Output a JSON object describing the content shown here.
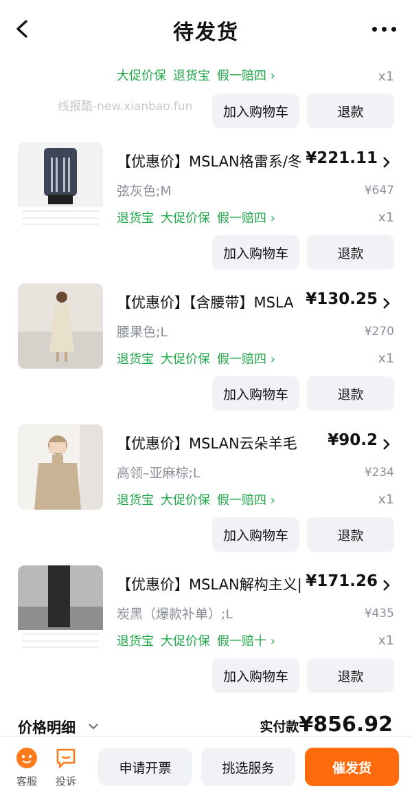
{
  "header": {
    "title": "待发货"
  },
  "watermark": "线报酷-new.xianbao.fun",
  "first_item_partial": {
    "tags": [
      "大促价保",
      "退货宝",
      "假一赔四 ›"
    ],
    "qty": "x1",
    "cart_label": "加入购物车",
    "refund_label": "退款"
  },
  "items": [
    {
      "title": "【优惠价】MSLAN格雷系/冬",
      "price": "¥221.11",
      "spec": "弦灰色;M",
      "orig_price": "¥647",
      "tags": [
        "退货宝",
        "大促价保",
        "假一赔四 ›"
      ],
      "qty": "x1",
      "cart_label": "加入购物车",
      "refund_label": "退款"
    },
    {
      "title": "【优惠价】【含腰带】MSLA",
      "price": "¥130.25",
      "spec": "腰果色;L",
      "orig_price": "¥270",
      "tags": [
        "退货宝",
        "大促价保",
        "假一赔四 ›"
      ],
      "qty": "x1",
      "cart_label": "加入购物车",
      "refund_label": "退款"
    },
    {
      "title": "【优惠价】MSLAN云朵羊毛",
      "price": "¥90.2",
      "spec": "高领–亚麻棕;L",
      "orig_price": "¥234",
      "tags": [
        "退货宝",
        "大促价保",
        "假一赔四 ›"
      ],
      "qty": "x1",
      "cart_label": "加入购物车",
      "refund_label": "退款"
    },
    {
      "title": "【优惠价】MSLAN解构主义|",
      "price": "¥171.26",
      "spec": "炭黑（爆款补单）;L",
      "orig_price": "¥435",
      "tags": [
        "退货宝",
        "大促价保",
        "假一赔十 ›"
      ],
      "qty": "x1",
      "cart_label": "加入购物车",
      "refund_label": "退款"
    }
  ],
  "summary": {
    "price_detail_label": "价格明细",
    "actual_label": "实付款",
    "actual_amount": "¥856.92"
  },
  "bottom_bar": {
    "service_label": "客服",
    "complain_label": "投诉",
    "invoice_label": "申请开票",
    "select_service_label": "挑选服务",
    "urge_label": "催发货"
  },
  "colors": {
    "accent": "#ff6a0c",
    "tag_green": "#21a74a",
    "muted": "#8a8f99",
    "button_bg": "#f0f2f5"
  },
  "icons": [
    "back-arrow-icon",
    "more-dots-icon",
    "chevron-right-icon",
    "chevron-down-icon",
    "customer-service-icon",
    "complaint-icon"
  ]
}
